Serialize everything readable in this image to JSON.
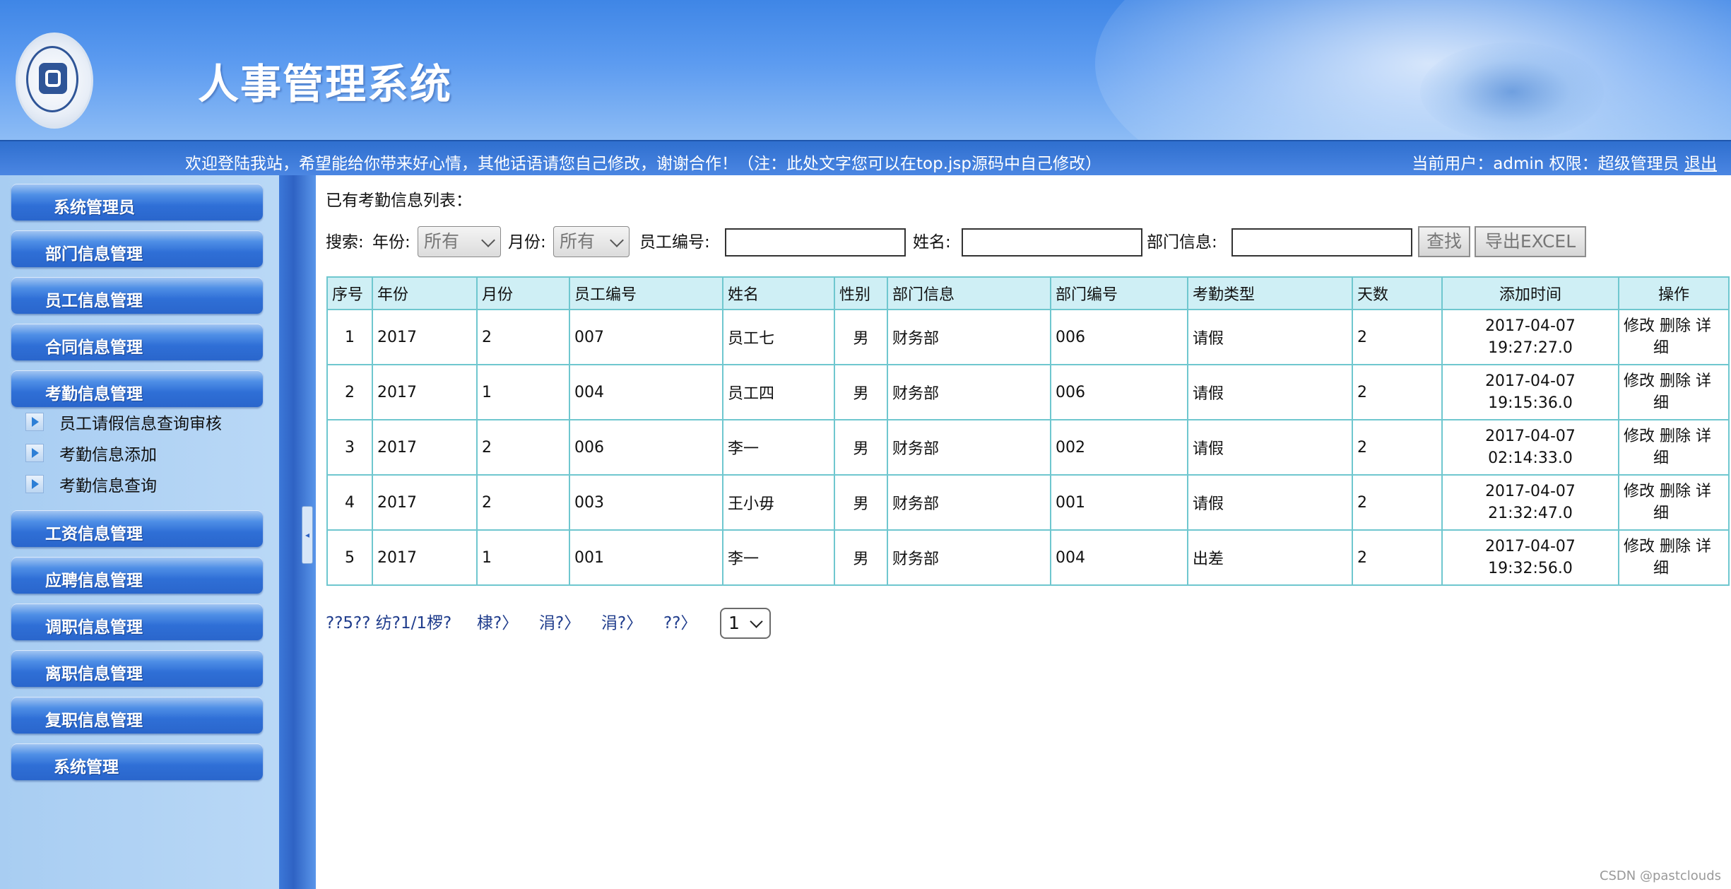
{
  "header": {
    "title": "人事管理系统",
    "welcome": "欢迎登陆我站，希望能给你带来好心情，其他话语请您自己修改，谢谢合作！（注：此处文字您可以在top.jsp源码中自己修改）",
    "user_info": "当前用户：admin 权限：超级管理员",
    "logout": "退出"
  },
  "sidebar": {
    "items": [
      {
        "label": "系统管理员"
      },
      {
        "label": "部门信息管理"
      },
      {
        "label": "员工信息管理"
      },
      {
        "label": "合同信息管理"
      },
      {
        "label": "考勤信息管理"
      },
      {
        "label": "工资信息管理"
      },
      {
        "label": "应聘信息管理"
      },
      {
        "label": "调职信息管理"
      },
      {
        "label": "离职信息管理"
      },
      {
        "label": "复职信息管理"
      },
      {
        "label": "系统管理"
      }
    ],
    "sub_items": [
      {
        "label": "员工请假信息查询审核"
      },
      {
        "label": "考勤信息添加"
      },
      {
        "label": "考勤信息查询"
      }
    ]
  },
  "main": {
    "list_title": "已有考勤信息列表：",
    "search": {
      "label": "搜索:",
      "year_label": "年份:",
      "year_value": "所有",
      "month_label": "月份:",
      "month_value": "所有",
      "emp_no_label": "员工编号:",
      "name_label": "姓名:",
      "dept_label": "部门信息:",
      "find_button": "查找",
      "export_button": "导出EXCEL"
    },
    "table": {
      "headers": [
        "序号",
        "年份",
        "月份",
        "员工编号",
        "姓名",
        "性别",
        "部门信息",
        "部门编号",
        "考勤类型",
        "天数",
        "添加时间",
        "操作"
      ],
      "rows": [
        {
          "no": "1",
          "year": "2017",
          "month": "2",
          "emp_no": "007",
          "name": "员工七",
          "gender": "男",
          "dept": "财务部",
          "dept_no": "006",
          "type": "请假",
          "days": "2",
          "date": "2017-04-07",
          "time": "19:27:27.0"
        },
        {
          "no": "2",
          "year": "2017",
          "month": "1",
          "emp_no": "004",
          "name": "员工四",
          "gender": "男",
          "dept": "财务部",
          "dept_no": "006",
          "type": "请假",
          "days": "2",
          "date": "2017-04-07",
          "time": "19:15:36.0"
        },
        {
          "no": "3",
          "year": "2017",
          "month": "2",
          "emp_no": "006",
          "name": "李一",
          "gender": "男",
          "dept": "财务部",
          "dept_no": "002",
          "type": "请假",
          "days": "2",
          "date": "2017-04-07",
          "time": "02:14:33.0"
        },
        {
          "no": "4",
          "year": "2017",
          "month": "2",
          "emp_no": "003",
          "name": "王小毋",
          "gender": "男",
          "dept": "财务部",
          "dept_no": "001",
          "type": "请假",
          "days": "2",
          "date": "2017-04-07",
          "time": "21:32:47.0"
        },
        {
          "no": "5",
          "year": "2017",
          "month": "1",
          "emp_no": "001",
          "name": "李一",
          "gender": "男",
          "dept": "财务部",
          "dept_no": "004",
          "type": "出差",
          "days": "2",
          "date": "2017-04-07",
          "time": "19:32:56.0"
        }
      ],
      "ops": {
        "edit": "修改",
        "delete": "删除",
        "detail_1": "详",
        "detail_2": "细"
      }
    },
    "pager": {
      "info": "??5?? 纺?1/1椤?",
      "first": "棣?〉",
      "prev": "涓?〉",
      "next": "涓?〉",
      "last": "??〉",
      "page_value": "1"
    }
  },
  "watermark": "CSDN @pastclouds"
}
